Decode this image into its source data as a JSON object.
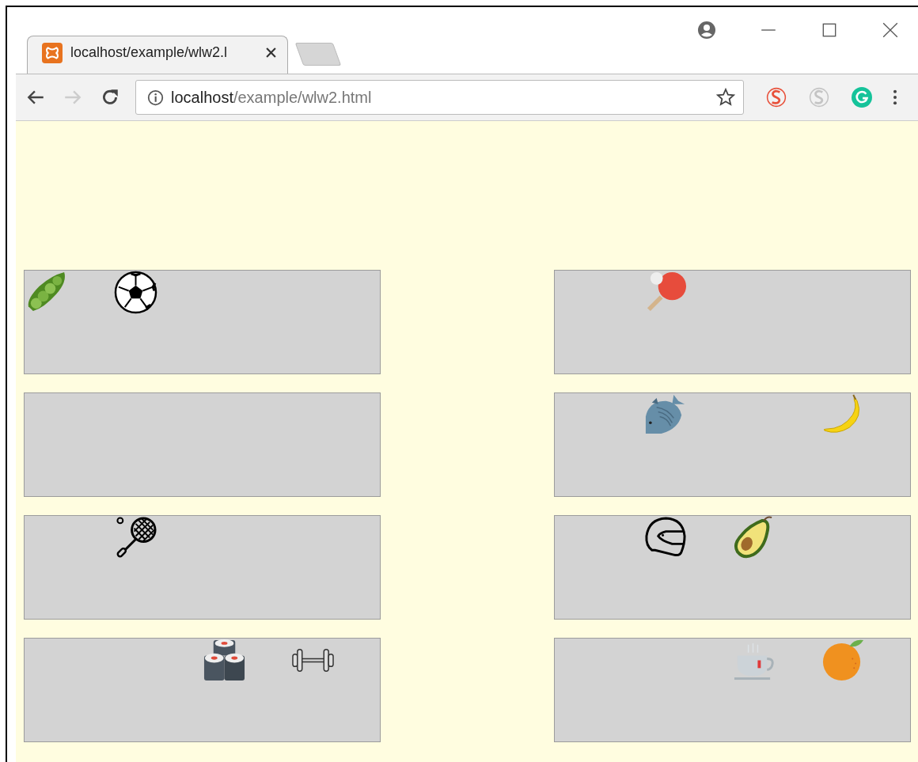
{
  "tab": {
    "title": "localhost/example/wlw2.l"
  },
  "toolbar": {
    "back_enabled": true,
    "forward_enabled": false
  },
  "address": {
    "host": "localhost",
    "path": "/example/wlw2.html"
  },
  "extensions": [
    {
      "kind": "s-logo",
      "color": "#e8503a"
    },
    {
      "kind": "s-logo",
      "color": "#c4c4c4"
    },
    {
      "kind": "g-logo",
      "color": "#15c39a"
    }
  ],
  "boxes": [
    {
      "slots": [
        {
          "kind": "pea-pod"
        },
        {
          "kind": "soccer-ball"
        },
        {
          "kind": "empty"
        },
        {
          "kind": "empty"
        }
      ]
    },
    {
      "slots": [
        {
          "kind": "empty"
        },
        {
          "kind": "ping-pong-paddle"
        },
        {
          "kind": "empty"
        },
        {
          "kind": "empty"
        }
      ]
    },
    {
      "slots": [
        {
          "kind": "empty"
        },
        {
          "kind": "empty"
        },
        {
          "kind": "empty"
        },
        {
          "kind": "empty"
        }
      ]
    },
    {
      "slots": [
        {
          "kind": "empty"
        },
        {
          "kind": "fish"
        },
        {
          "kind": "empty"
        },
        {
          "kind": "banana"
        }
      ]
    },
    {
      "slots": [
        {
          "kind": "empty"
        },
        {
          "kind": "tennis-racket"
        },
        {
          "kind": "empty"
        },
        {
          "kind": "empty"
        }
      ]
    },
    {
      "slots": [
        {
          "kind": "empty"
        },
        {
          "kind": "helmet"
        },
        {
          "kind": "avocado"
        },
        {
          "kind": "empty"
        }
      ]
    },
    {
      "slots": [
        {
          "kind": "empty"
        },
        {
          "kind": "empty"
        },
        {
          "kind": "sushi"
        },
        {
          "kind": "dumbbell"
        }
      ]
    },
    {
      "slots": [
        {
          "kind": "empty"
        },
        {
          "kind": "empty"
        },
        {
          "kind": "tea-cup"
        },
        {
          "kind": "orange"
        }
      ]
    }
  ]
}
